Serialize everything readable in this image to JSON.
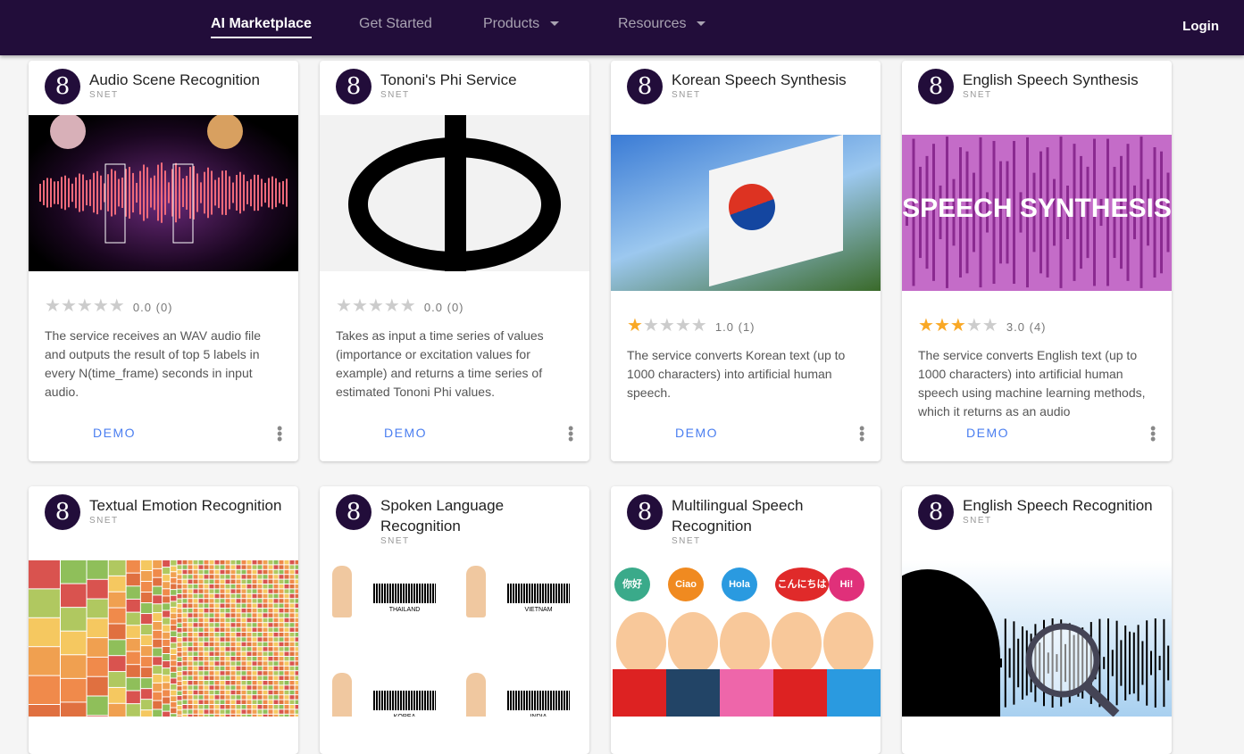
{
  "nav": {
    "items": [
      "AI Marketplace",
      "Get Started",
      "Products",
      "Resources"
    ],
    "login": "Login"
  },
  "cards": [
    {
      "title": "Audio Scene Recognition",
      "org": "SNET",
      "rating": 0,
      "rating_text": "0.0",
      "count": "(0)",
      "desc": "The service receives an WAV audio file and outputs the result of top 5 labels in every N(time_frame) seconds in input audio.",
      "demo": "DEMO"
    },
    {
      "title": "Tononi's Phi Service",
      "org": "SNET",
      "rating": 0,
      "rating_text": "0.0",
      "count": "(0)",
      "desc": "Takes as input a time series of values (importance or excitation values for example) and returns a time series of estimated Tononi Phi values.",
      "demo": "DEMO"
    },
    {
      "title": "Korean Speech Synthesis",
      "org": "SNET",
      "rating": 1,
      "rating_text": "1.0",
      "count": "(1)",
      "desc": "The service converts Korean text (up to 1000 characters) into artificial human speech.",
      "demo": "DEMO"
    },
    {
      "title": "English Speech Synthesis",
      "org": "SNET",
      "rating": 3,
      "rating_text": "3.0",
      "count": "(4)",
      "desc": "The service converts English text (up to 1000 characters) into artificial human speech using machine learning methods, which it returns as an audio",
      "demo": "DEMO",
      "image_text": "SPEECH SYNTHESIS"
    },
    {
      "title": "Textual Emotion Recognition",
      "org": "SNET"
    },
    {
      "title": "Spoken Language Recognition",
      "org": "SNET",
      "image_labels": [
        "THAILAND",
        "VIETNAM",
        "KOREA",
        "INDIA"
      ]
    },
    {
      "title": "Multilingual Speech Recognition",
      "org": "SNET",
      "image_labels": [
        "你好",
        "Ciao",
        "Hola",
        "こんにちは",
        "Hi!"
      ]
    },
    {
      "title": "English Speech Recognition",
      "org": "SNET"
    }
  ]
}
